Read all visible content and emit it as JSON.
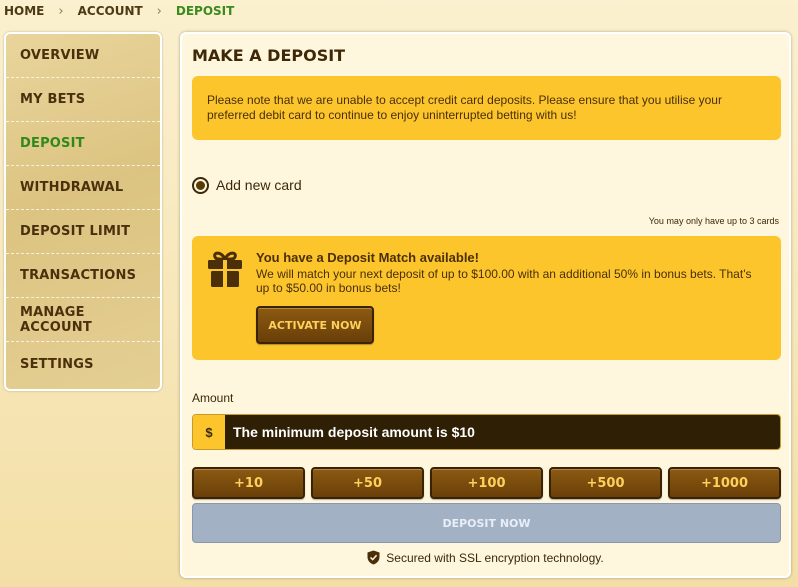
{
  "breadcrumb": {
    "items": [
      "HOME",
      "ACCOUNT",
      "DEPOSIT"
    ]
  },
  "sidebar": {
    "items": [
      {
        "label": "OVERVIEW"
      },
      {
        "label": "MY BETS"
      },
      {
        "label": "DEPOSIT",
        "active": true
      },
      {
        "label": "WITHDRAWAL"
      },
      {
        "label": "DEPOSIT LIMIT"
      },
      {
        "label": "TRANSACTIONS"
      },
      {
        "label": "MANAGE ACCOUNT"
      },
      {
        "label": "SETTINGS"
      }
    ]
  },
  "deposit": {
    "title": "MAKE A DEPOSIT",
    "notice": "Please note that we are unable to accept credit card deposits. Please ensure that you utilise your preferred debit card to continue to enjoy uninterrupted betting with us!",
    "add_card_label": "Add new card",
    "card_limit_note": "You may only have up to 3 cards",
    "promo": {
      "icon": "gift-icon",
      "title": "You have a Deposit Match available!",
      "text": "We will match your next deposit of up to $100.00 with an additional 50% in bonus bets. That's up to $50.00 in bonus bets!",
      "button_label": "ACTIVATE NOW"
    },
    "amount_label": "Amount",
    "currency_symbol": "$",
    "amount_placeholder": "The minimum deposit amount is $10",
    "quick_amounts": [
      "+10",
      "+50",
      "+100",
      "+500",
      "+1000"
    ],
    "submit_label": "DEPOSIT NOW",
    "ssl_text": "Secured with SSL encryption technology."
  },
  "colors": {
    "accent_yellow": "#fdc52c",
    "button_brown": "#6a3f08",
    "active_green": "#2f8a1a",
    "disabled_button": "#a3b1c5"
  }
}
